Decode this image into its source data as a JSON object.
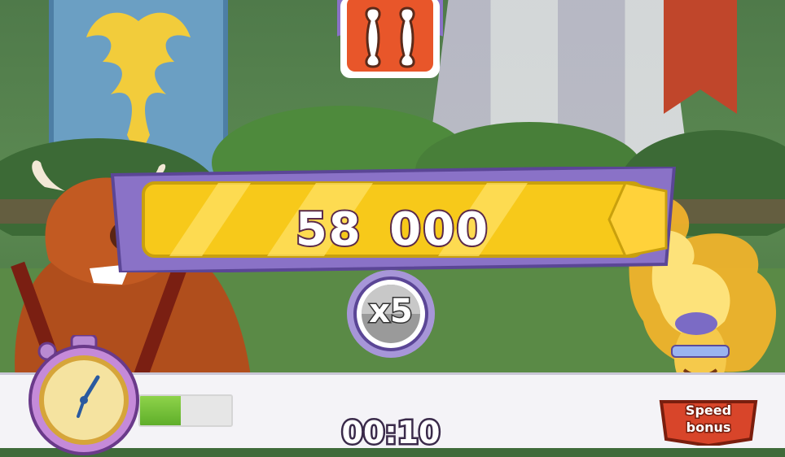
{
  "hud": {
    "score": "58 000",
    "multiplier": "x5",
    "timer": "00:10",
    "timer_progress": 0.45,
    "speed_bonus_line1": "Speed",
    "speed_bonus_line2": "bonus"
  },
  "icons": {
    "pause": "pause-icon",
    "stopwatch": "stopwatch-icon",
    "speed_bonus": "speed-bonus-icon"
  },
  "colors": {
    "score_bar": "#f7c91a",
    "panel_frame": "#8a72c7",
    "pause_button": "#e8562a",
    "timer_fill": "#6fbe33",
    "speed_bonus": "#d8452a"
  }
}
